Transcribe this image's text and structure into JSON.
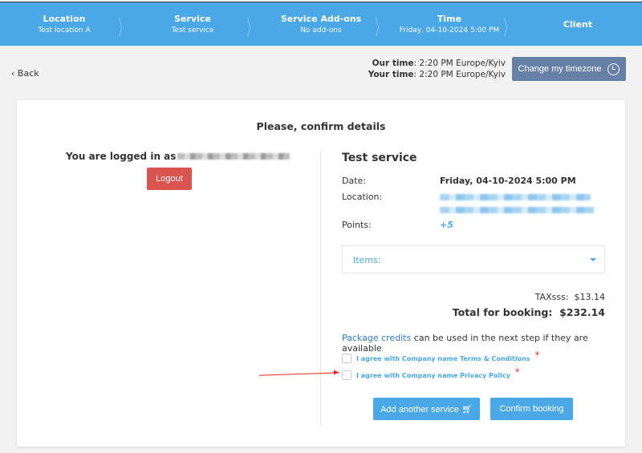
{
  "steps": [
    {
      "title": "Location",
      "sub": "Test location A"
    },
    {
      "title": "Service",
      "sub": "Test service"
    },
    {
      "title": "Service Add-ons",
      "sub": "No add-ons"
    },
    {
      "title": "Time",
      "sub": "Friday, 04-10-2024 5:00 PM"
    },
    {
      "title": "Client",
      "sub": ""
    }
  ],
  "back_label": "Back",
  "times": {
    "our_label": "Our time",
    "our_value": ": 2:20 PM Europe/Kyiv",
    "your_label": "Your time",
    "your_value": ": 2:20 PM Europe/Kyiv"
  },
  "tz_button": "Change my timezone",
  "card": {
    "title": "Please, confirm details",
    "logged_in": "You are logged in as",
    "logout": "Logout",
    "service": "Test service",
    "date_label": "Date:",
    "date_value": "Friday, 04-10-2024 5:00 PM",
    "location_label": "Location:",
    "points_label": "Points:",
    "points_value": "+5",
    "items_label": "Items:",
    "tax": "TAXsss:  $13.14",
    "total": "Total for booking:  $232.14",
    "package_link": "Package credits",
    "package_text": " can be used in the next step if they are available",
    "terms": "I agree with Company name Terms & Conditions",
    "privacy": "I agree with Company name Privacy Policy",
    "required": "*",
    "add_service": "Add another service",
    "confirm": "Confirm booking"
  }
}
